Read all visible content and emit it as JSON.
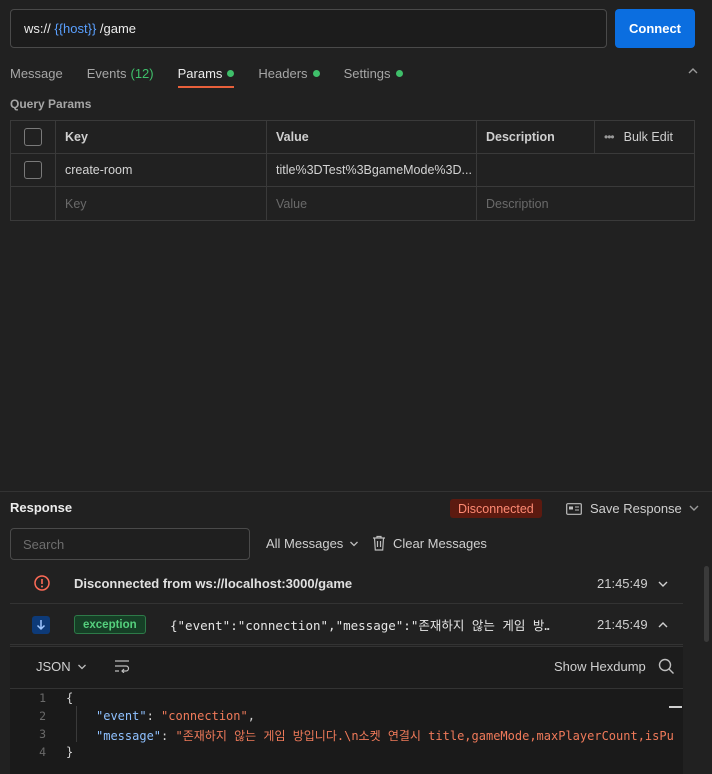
{
  "url": {
    "prefix": "ws:// ",
    "variable": "{{host}}",
    "suffix": " /game"
  },
  "connect_label": "Connect",
  "tabs": [
    {
      "label": "Message"
    },
    {
      "label": "Events",
      "count": "(12)"
    },
    {
      "label": "Params",
      "active": true
    },
    {
      "label": "Headers"
    },
    {
      "label": "Settings"
    }
  ],
  "query_params": {
    "title": "Query Params",
    "headers": {
      "key": "Key",
      "value": "Value",
      "description": "Description",
      "bulk_edit": "Bulk Edit"
    },
    "rows": [
      {
        "key": "create-room",
        "value": "title%3DTest%3BgameMode%3D..."
      }
    ],
    "placeholder": {
      "key": "Key",
      "value": "Value",
      "description": "Description"
    }
  },
  "response": {
    "title": "Response",
    "status": "Disconnected",
    "save_label": "Save Response",
    "search_placeholder": "Search",
    "filter_label": "All Messages",
    "clear_label": "Clear Messages",
    "messages": [
      {
        "text": "Disconnected from ws://localhost:3000/game",
        "time": "21:45:49"
      },
      {
        "badge": "exception",
        "text": "{\"event\":\"connection\",\"message\":\"존재하지 않는 게임 방…",
        "time": "21:45:49"
      }
    ],
    "detail": {
      "format": "JSON",
      "hexdump_label": "Show Hexdump",
      "lines": [
        {
          "n": "1",
          "open": "{"
        },
        {
          "n": "2",
          "key": "\"event\"",
          "value": "\"connection\""
        },
        {
          "n": "3",
          "key": "\"message\"",
          "value": "\"존재하지 않는 게임 방입니다.\\n소켓 연결시 title,gameMode,maxPlayerCount,isPu"
        },
        {
          "n": "4",
          "close": "}"
        }
      ]
    }
  },
  "colors": {
    "accent": "#e8603b",
    "primary": "#0b6ee0",
    "success": "#3fbf6a",
    "error": "#ff8a73"
  }
}
